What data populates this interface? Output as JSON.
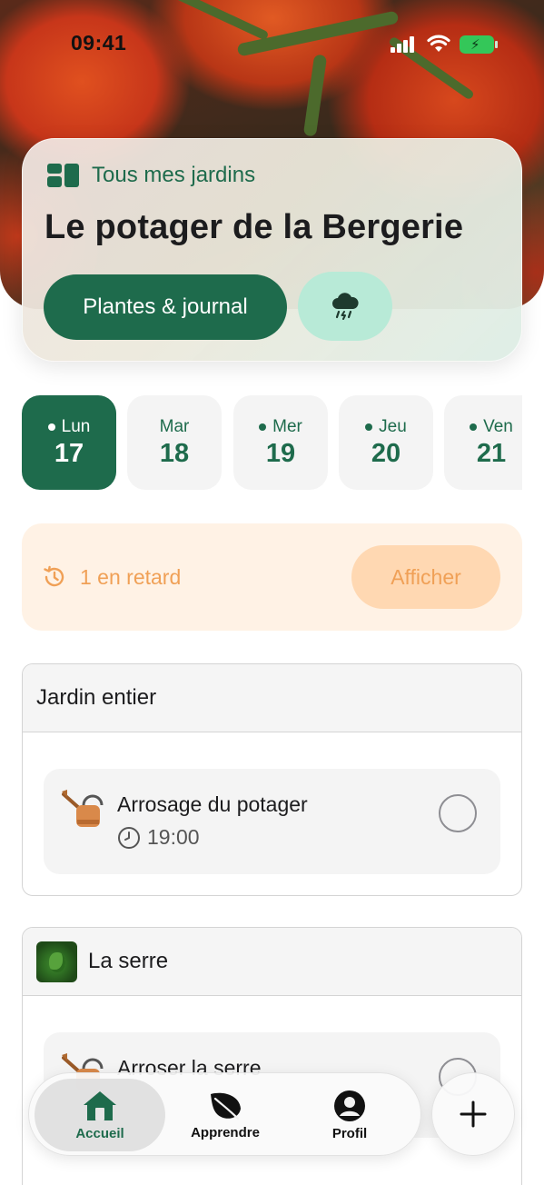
{
  "status_bar": {
    "time": "09:41"
  },
  "garden": {
    "all_gardens_label": "Tous mes jardins",
    "title": "Le potager de la Bergerie",
    "plants_button_label": "Plantes & journal",
    "weather_icon": "cloud-rain-lightning-icon"
  },
  "days": [
    {
      "name": "Lun",
      "number": "17",
      "has_tasks": true,
      "selected": true
    },
    {
      "name": "Mar",
      "number": "18",
      "has_tasks": false,
      "selected": false
    },
    {
      "name": "Mer",
      "number": "19",
      "has_tasks": true,
      "selected": false
    },
    {
      "name": "Jeu",
      "number": "20",
      "has_tasks": true,
      "selected": false
    },
    {
      "name": "Ven",
      "number": "21",
      "has_tasks": true,
      "selected": false
    }
  ],
  "late_banner": {
    "text": "1 en retard",
    "button_label": "Afficher"
  },
  "sections": [
    {
      "title": "Jardin entier",
      "task_title": "Arrosage du potager",
      "task_time": "19:00"
    },
    {
      "title": "La serre",
      "task_title": "Arroser la serre",
      "task_time": ""
    }
  ],
  "tabs": [
    {
      "label": "Accueil",
      "icon": "home-icon"
    },
    {
      "label": "Apprendre",
      "icon": "leaf-icon"
    },
    {
      "label": "Profil",
      "icon": "profile-icon"
    }
  ],
  "colors": {
    "brand_green": "#1e6b4c",
    "late_orange": "#f0a056",
    "weather_mint": "#b8ead7"
  }
}
